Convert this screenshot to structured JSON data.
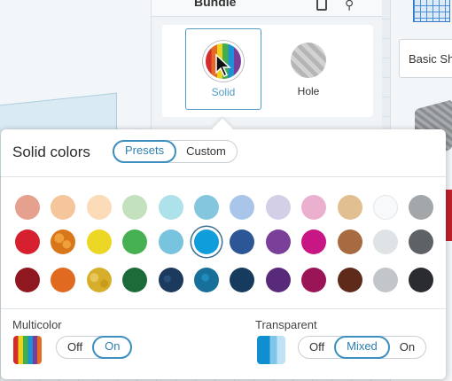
{
  "inspector": {
    "title": "Bundle",
    "type_options": [
      {
        "label": "Solid",
        "selected": true
      },
      {
        "label": "Hole",
        "selected": false
      }
    ]
  },
  "sidebar": {
    "category_label": "Basic Shapes"
  },
  "popup": {
    "title": "Solid colors",
    "tabs": [
      {
        "label": "Presets",
        "active": true
      },
      {
        "label": "Custom",
        "active": false
      }
    ],
    "swatch_rows": [
      [
        "#e5a08e",
        "#f5c59b",
        "#fcdcb8",
        "#c4e1bd",
        "#ade2ea",
        "#85c6df",
        "#a9c6ea",
        "#d2cfe6",
        "#ebb0cd",
        "#e2bf90",
        "#f7f9fa",
        "#a3a7a9"
      ],
      [
        "#d6202f",
        "#d9761a",
        "#ecd824",
        "#46b152",
        "#78c3de",
        "#0f9ddb",
        "#2c5696",
        "#7a3f98",
        "#c81684",
        "#a86a40",
        "#dfe3e5",
        "#5e6166"
      ],
      [
        "#8f1820",
        "#e06b20",
        "#d6ae2a",
        "#1e6b3a",
        "#1c3a5e",
        "#17709a",
        "#173b5e",
        "#5a2a7a",
        "#9a1456",
        "#5e2a1a",
        "#c2c6ca",
        "#2a2c30"
      ]
    ],
    "selected_swatch": {
      "row": 1,
      "index": 5
    },
    "multicolor": {
      "label": "Multicolor",
      "options": [
        {
          "label": "Off",
          "active": false
        },
        {
          "label": "On",
          "active": true
        }
      ]
    },
    "transparent": {
      "label": "Transparent",
      "options": [
        {
          "label": "Off",
          "active": false
        },
        {
          "label": "Mixed",
          "active": true
        },
        {
          "label": "On",
          "active": false
        }
      ]
    }
  }
}
